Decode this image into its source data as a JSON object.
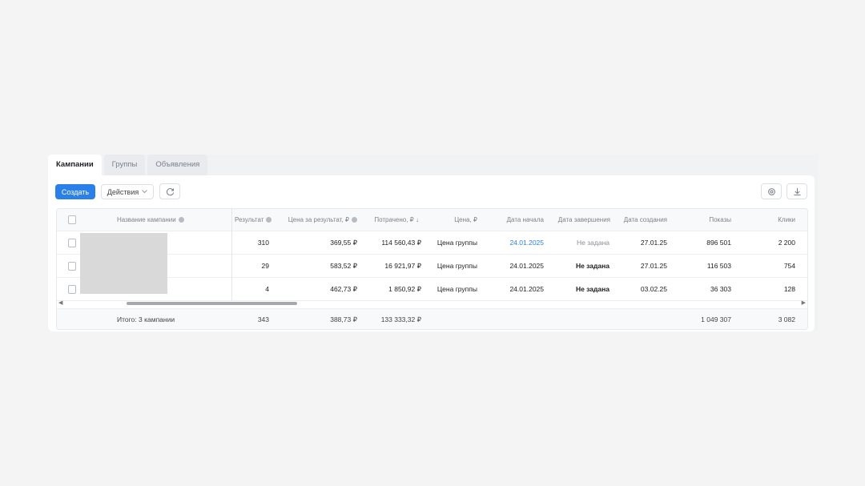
{
  "tabs": [
    {
      "label": "Кампании",
      "active": true
    },
    {
      "label": "Группы",
      "active": false
    },
    {
      "label": "Объявления",
      "active": false
    }
  ],
  "toolbar": {
    "create_label": "Создать",
    "actions_label": "Действия",
    "refresh_icon": "refresh-icon",
    "settings_icon": "gear-icon",
    "download_icon": "download-icon"
  },
  "table": {
    "headers": {
      "name": "Название кампании",
      "result": "Результат",
      "cost_per_result": "Цена за результат, ₽",
      "spent": "Потрачено, ₽",
      "spent_sort": "↓",
      "price": "Цена, ₽",
      "start_date": "Дата начала",
      "end_date": "Дата завершения",
      "created": "Дата создания",
      "impressions": "Показы",
      "clicks": "Клики"
    },
    "rows": [
      {
        "result": "310",
        "cost_per_result": "369,55 ₽",
        "spent": "114 560,43 ₽",
        "price": "Цена группы",
        "start_date": "24.01.2025",
        "end_date": "Не задана",
        "created": "27.01.25",
        "impressions": "896 501",
        "clicks": "2 200"
      },
      {
        "result": "29",
        "cost_per_result": "583,52 ₽",
        "spent": "16 921,97 ₽",
        "price": "Цена группы",
        "start_date": "24.01.2025",
        "end_date": "Не задана",
        "created": "27.01.25",
        "impressions": "116 503",
        "clicks": "754"
      },
      {
        "result": "4",
        "cost_per_result": "462,73 ₽",
        "spent": "1 850,92 ₽",
        "price": "Цена группы",
        "start_date": "24.01.2025",
        "end_date": "Не задана",
        "created": "03.02.25",
        "impressions": "36 303",
        "clicks": "128"
      }
    ],
    "total": {
      "label": "Итого: 3 кампании",
      "result": "343",
      "cost_per_result": "388,73 ₽",
      "spent": "133 333,32 ₽",
      "impressions": "1 049 307",
      "clicks": "3 082"
    }
  },
  "colors": {
    "accent": "#2b7fe8",
    "background": "#f4f4f4"
  }
}
